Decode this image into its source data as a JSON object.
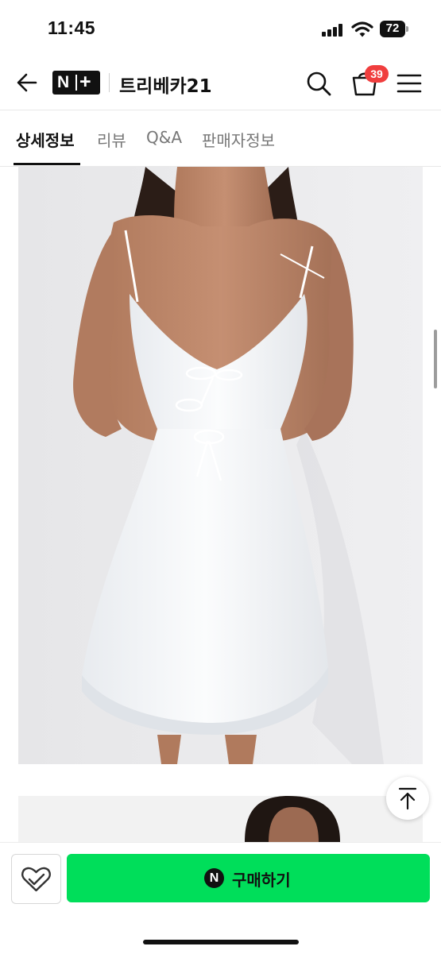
{
  "status_bar": {
    "time": "11:45",
    "battery": "72"
  },
  "header": {
    "logo_n": "N",
    "logo_plus": "+",
    "store_name": "트리베카21",
    "cart_count": "39"
  },
  "tabs": [
    {
      "label": "상세정보",
      "active": true
    },
    {
      "label": "리뷰",
      "active": false
    },
    {
      "label": "Q&A",
      "active": false
    },
    {
      "label": "판매자정보",
      "active": false
    }
  ],
  "bottom_bar": {
    "buy_badge": "N",
    "buy_label": "구매하기"
  },
  "colors": {
    "buy_button": "#00de5a",
    "badge": "#f03e3e",
    "text": "#111111"
  },
  "icons": [
    "back-arrow-icon",
    "search-icon",
    "shopping-bag-icon",
    "hamburger-menu-icon",
    "scroll-top-icon",
    "heart-check-icon"
  ]
}
